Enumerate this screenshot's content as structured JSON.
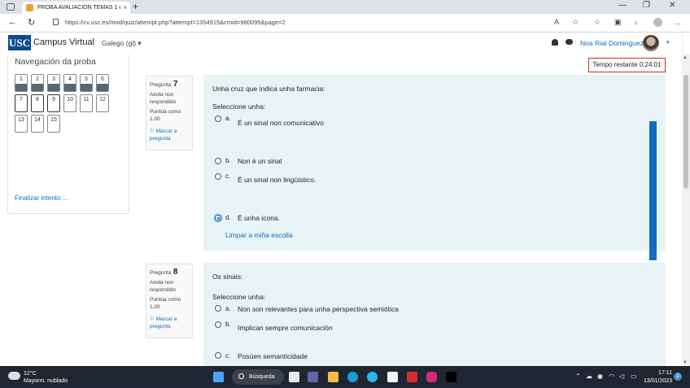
{
  "browser": {
    "tab_title": "PROBA AVALIACIÓN TEMAS 1 e...",
    "tab_close": "×",
    "new_tab": "+",
    "url": "https://cv.usc.es/mod/quiz/attempt.php?attempt=1354915&cmid=980095&page=2"
  },
  "header": {
    "logo": "USC",
    "site_name": "Campus Virtual",
    "language": "Galego (gl) ▾",
    "user_name": "Noa Rial Dominguez",
    "caret": "▾"
  },
  "quiz_nav": {
    "title": "Navegación da proba",
    "buttons": [
      "1",
      "2",
      "3",
      "4",
      "5",
      "6",
      "7",
      "8",
      "9",
      "10",
      "11",
      "12",
      "13",
      "14",
      "15"
    ],
    "finish_label": "Finalizar intento ..."
  },
  "timer": {
    "text": "Tempo restante 0:24:01"
  },
  "questions": [
    {
      "label": "Pregunta",
      "number": "7",
      "state": "Ainda non respondido",
      "mark": "Puntúa como 1,00",
      "flag": "Marcar a pregunta",
      "text": "Unha cruz que indica unha farmacia:",
      "prompt": "Seleccione unha:",
      "options": [
        {
          "letter": "a.",
          "text": "É un sinal non comunicativo",
          "checked": false
        },
        {
          "letter": "b.",
          "text": "Non é un sinal",
          "checked": false
        },
        {
          "letter": "c.",
          "text": "É un sinal non lingüístico.",
          "checked": false
        },
        {
          "letter": "d.",
          "text": "É unha icona.",
          "checked": true
        }
      ],
      "clear_label": "Limpar a miña escolla"
    },
    {
      "label": "Pregunta",
      "number": "8",
      "state": "Ainda non respondido",
      "mark": "Puntúa como 1,00",
      "flag": "Marcar a pregunta",
      "text": "Os sinais:",
      "prompt": "Seleccione unha:",
      "options": [
        {
          "letter": "a.",
          "text": "Non son relevantes para unha perspectiva semiótica",
          "checked": false
        },
        {
          "letter": "b.",
          "text": "Implican sempre comunicación",
          "checked": false
        },
        {
          "letter": "c.",
          "text": "Posúen semanticidade",
          "checked": false
        }
      ]
    }
  ],
  "taskbar": {
    "temperature": "12°C",
    "weather": "Mayorm. nublado",
    "search": "Búsqueda",
    "time": "17:11",
    "date": "13/01/2023",
    "notifications": "2"
  }
}
